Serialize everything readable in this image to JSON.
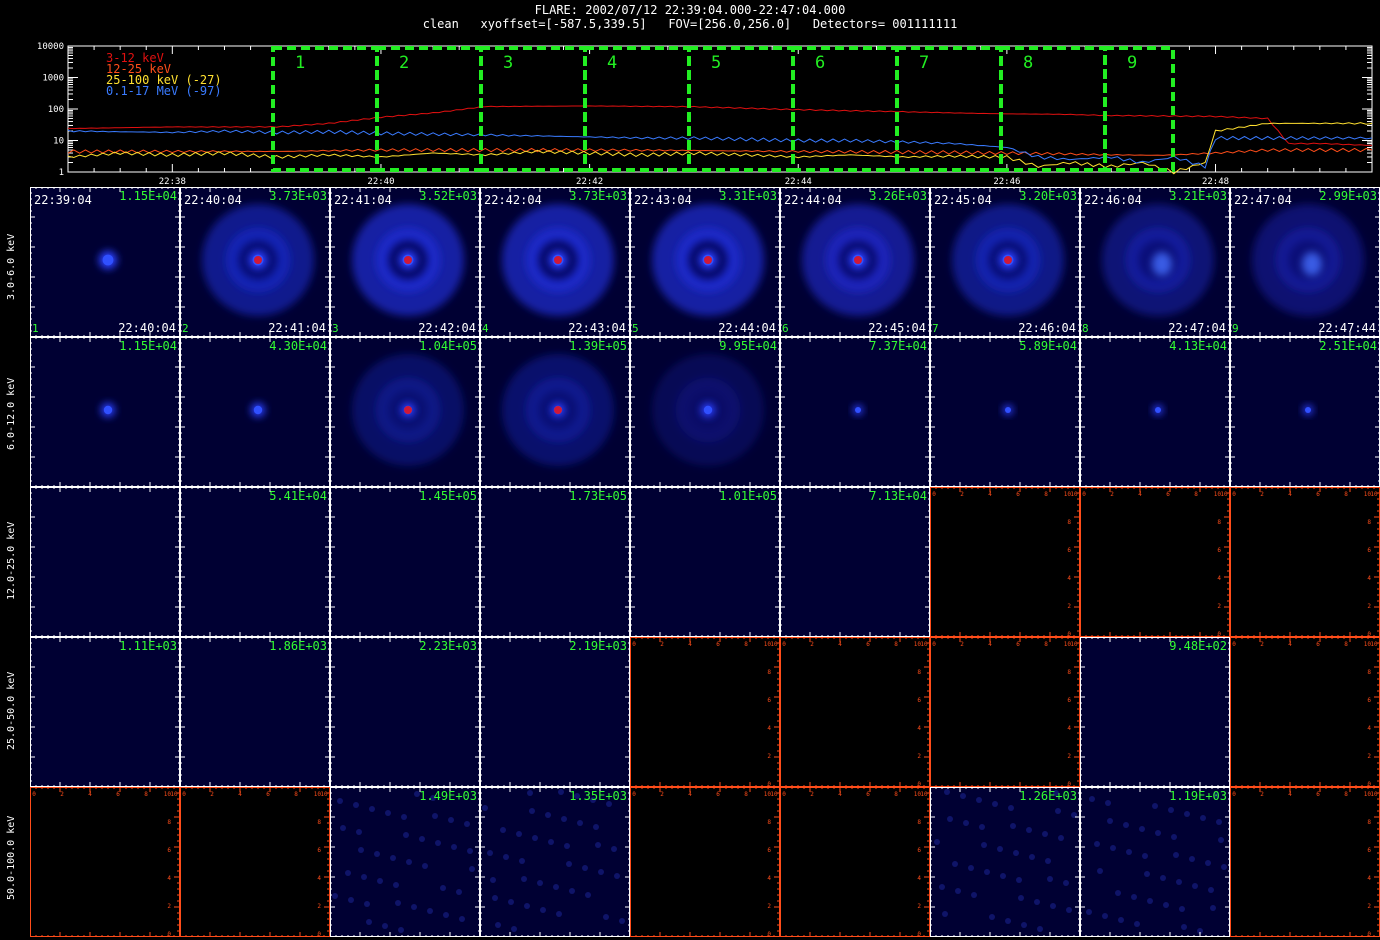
{
  "title_line1": "FLARE: 2002/07/12 22:39:04.000-22:47:04.000",
  "title_line2": "clean   xyoffset=[-587.5,339.5]   FOV=[256.0,256.0]   Detectors= 001111111",
  "colors": {
    "red": "#e01010",
    "orange": "#ff4d1a",
    "yellow": "#ffe030",
    "blue": "#3a7bff",
    "green": "#22ee22",
    "axis": "#ffffff",
    "img_bg": "#000033",
    "frame": "#ffffff",
    "frame_alt": "#ff4d1a"
  },
  "chart_data": [
    {
      "type": "line",
      "yscale": "log",
      "ylim": [
        1,
        10000
      ],
      "yticks": [
        "1",
        "10",
        "100",
        "1000",
        "10000"
      ],
      "xticks": [
        "22:38",
        "22:40",
        "22:42",
        "22:44",
        "22:46",
        "22:48"
      ],
      "xlim_min": [
        37,
        49.5
      ],
      "xtick_min": [
        38,
        40,
        42,
        44,
        46,
        48
      ],
      "series": [
        {
          "name": "3-12 keV",
          "color": "#e01010",
          "x": [
            37,
            38,
            39,
            39.5,
            40,
            40.5,
            41,
            42,
            43,
            44,
            45,
            45.5,
            46,
            46.5,
            47,
            47.5,
            48,
            48.5,
            48.7,
            49,
            49.5
          ],
          "y": [
            24,
            27,
            27,
            35,
            55,
            75,
            120,
            125,
            118,
            95,
            82,
            75,
            70,
            68,
            62,
            60,
            58,
            50,
            8,
            8,
            7
          ]
        },
        {
          "name": "12-25 keV",
          "color": "#ff4d1a",
          "x": [
            37,
            38,
            39,
            40,
            41,
            42,
            43,
            44,
            45,
            45.5,
            46,
            46.5,
            47,
            47.5,
            48,
            48.5,
            49,
            49.5
          ],
          "y": [
            4.5,
            4.5,
            4.5,
            5,
            5,
            5,
            4.8,
            4.5,
            4.3,
            4.2,
            4.0,
            3.8,
            3.5,
            3.4,
            4,
            5,
            5,
            5
          ]
        },
        {
          "name": "25-100 keV (-27)",
          "color": "#ffe030",
          "x": [
            37,
            37.5,
            38,
            38.5,
            39,
            39.5,
            40,
            40.5,
            41,
            41.5,
            42,
            42.5,
            43,
            43.5,
            44,
            44.5,
            45,
            45.5,
            46,
            46.3,
            46.6,
            47,
            47.3,
            47.6,
            47.9,
            48,
            48.5,
            49,
            49.5
          ],
          "y": [
            3,
            4,
            3.5,
            4,
            3,
            3.5,
            3,
            4,
            3.5,
            4.5,
            4,
            3.5,
            4,
            3.5,
            3,
            3.5,
            3,
            3.2,
            3,
            1.5,
            2,
            1.5,
            2,
            1,
            2,
            20,
            35,
            35,
            35
          ]
        },
        {
          "name": "0.1-17 MeV (-97)",
          "color": "#3a7bff",
          "x": [
            37,
            38,
            38.5,
            39,
            39.5,
            40,
            40.5,
            41,
            41.5,
            42,
            42.5,
            43,
            43.5,
            44,
            44.5,
            45,
            45.5,
            46,
            46.3,
            46.6,
            47,
            47.3,
            47.6,
            47.9,
            48,
            48.5,
            49,
            49.5
          ],
          "y": [
            20,
            18,
            20,
            18,
            19,
            17,
            16,
            15,
            14,
            13,
            12,
            12,
            11,
            10,
            10,
            9,
            8,
            6,
            3,
            2.5,
            3,
            2,
            3,
            1.5,
            12,
            12,
            12,
            12
          ]
        }
      ]
    },
    {
      "type": "heatmap",
      "row_labels": [
        "3.0-6.0 keV",
        "6.0-12.0 keV",
        "12.0-25.0 keV",
        "25.0-50.0 keV",
        "50.0-100.0 keV"
      ],
      "col_numbers": [
        "1",
        "2",
        "3",
        "4",
        "5",
        "6",
        "7",
        "8",
        "9"
      ],
      "start_times": [
        "22:39:04",
        "22:40:04",
        "22:41:04",
        "22:42:04",
        "22:43:04",
        "22:44:04",
        "22:45:04",
        "22:46:04",
        "22:47:04"
      ],
      "end_times": [
        "22:40:04",
        "22:41:04",
        "22:42:04",
        "22:43:04",
        "22:44:04",
        "22:45:04",
        "22:46:04",
        "22:47:04",
        "22:47:44"
      ],
      "maxima": [
        [
          "1.15E+04",
          "3.73E+03",
          "3.52E+03",
          "3.73E+03",
          "3.31E+03",
          "3.26E+03",
          "3.20E+03",
          "3.21E+03",
          "2.99E+03"
        ],
        [
          "1.15E+04",
          "4.30E+04",
          "1.04E+05",
          "1.39E+05",
          "9.95E+04",
          "7.37E+04",
          "5.89E+04",
          "4.13E+04",
          "2.51E+04"
        ],
        [
          "",
          "5.41E+04",
          "1.45E+05",
          "1.73E+05",
          "1.01E+05",
          "7.13E+04",
          "",
          "",
          ""
        ],
        [
          "1.11E+03",
          "1.86E+03",
          "2.23E+03",
          "2.19E+03",
          "",
          "",
          "",
          "9.48E+02",
          ""
        ],
        [
          "",
          "",
          "1.49E+03",
          "1.35E+03",
          "",
          "",
          "1.26E+03",
          "1.19E+03",
          ""
        ]
      ],
      "has_image": [
        [
          1,
          1,
          1,
          1,
          1,
          1,
          1,
          1,
          1
        ],
        [
          1,
          1,
          1,
          1,
          1,
          1,
          1,
          1,
          1
        ],
        [
          1,
          1,
          1,
          1,
          1,
          1,
          0,
          0,
          0
        ],
        [
          1,
          1,
          1,
          1,
          0,
          0,
          0,
          1,
          0
        ],
        [
          0,
          0,
          1,
          1,
          0,
          0,
          1,
          1,
          0
        ]
      ],
      "ring_strength": [
        [
          0.05,
          0.8,
          1.0,
          1.0,
          1.0,
          0.85,
          0.75,
          0.6,
          0.55
        ],
        [
          0,
          0,
          0.45,
          0.5,
          0.3,
          0,
          0,
          0,
          0
        ]
      ],
      "core_red": [
        [
          0,
          1,
          1,
          1,
          1,
          1,
          1,
          0,
          0
        ],
        [
          0,
          0,
          1,
          1,
          0,
          0,
          0,
          0,
          0
        ]
      ],
      "empty_ticks": [
        "0",
        "2",
        "4",
        "6",
        "8",
        "10"
      ]
    }
  ]
}
